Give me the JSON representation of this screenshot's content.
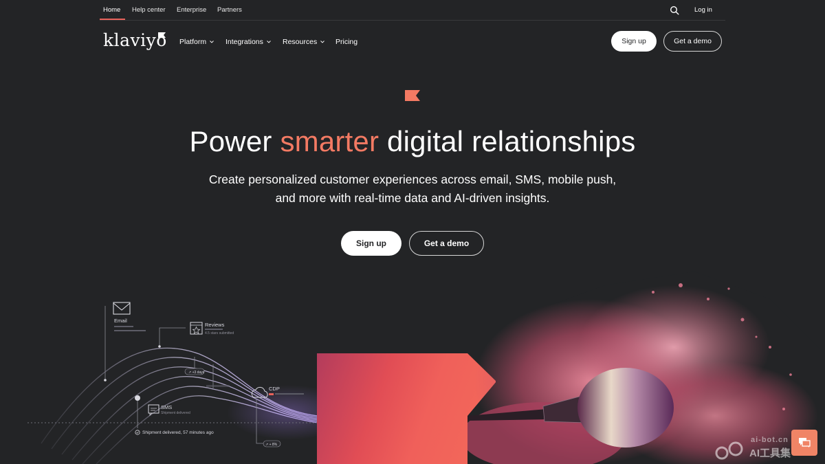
{
  "utility_nav": {
    "items": [
      "Home",
      "Help center",
      "Enterprise",
      "Partners"
    ],
    "login": "Log in"
  },
  "brand": {
    "name": "klaviyo",
    "accent_color": "#f37a63",
    "background": "#232426"
  },
  "main_nav": {
    "items": [
      {
        "label": "Platform",
        "has_dropdown": true
      },
      {
        "label": "Integrations",
        "has_dropdown": true
      },
      {
        "label": "Resources",
        "has_dropdown": true
      },
      {
        "label": "Pricing",
        "has_dropdown": false
      }
    ],
    "signup": "Sign up",
    "demo": "Get a demo"
  },
  "hero": {
    "title_before": "Power ",
    "title_accent": "smarter",
    "title_after": " digital relationships",
    "subtitle": "Create personalized customer experiences across email, SMS, mobile push, and more with real-time data and AI-driven insights.",
    "signup": "Sign up",
    "demo": "Get a demo"
  },
  "illustration": {
    "email": "Email",
    "reviews": "Reviews",
    "reviews_detail": "4.5 stars submitted",
    "days_badge": "↗ +3 days",
    "cdp": "CDP",
    "sms": "SMS",
    "sms_detail": "Shipment delivered",
    "shipment": "Shipment delivered, 57 minutes ago",
    "pct_badge": "↗ + 8%"
  },
  "chat": {
    "icon": "chat-bubble-icon"
  },
  "watermark": {
    "top": "ai-bot.cn",
    "bottom": "AI工具集"
  }
}
